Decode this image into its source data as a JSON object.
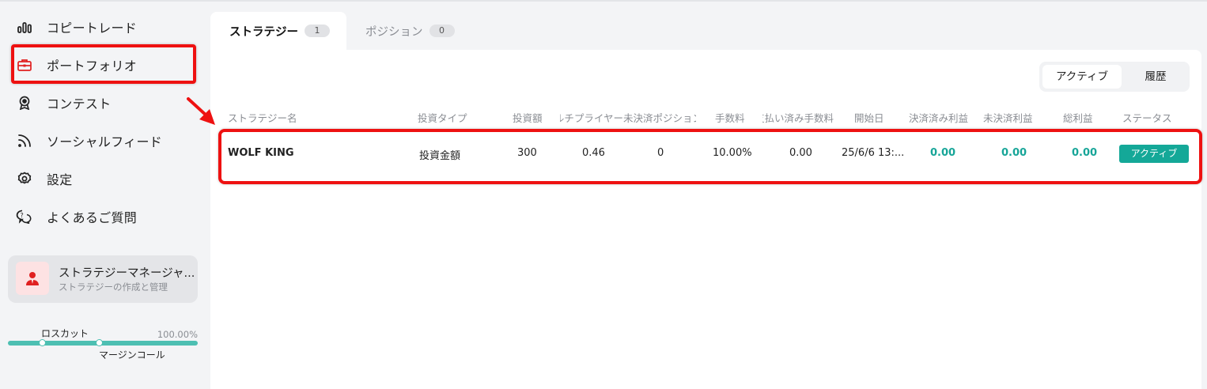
{
  "sidebar": {
    "items": [
      {
        "label": "コピートレード",
        "icon": "bar-chart-icon"
      },
      {
        "label": "ポートフォリオ",
        "icon": "briefcase-icon"
      },
      {
        "label": "コンテスト",
        "icon": "medal-icon"
      },
      {
        "label": "ソーシャルフィード",
        "icon": "rss-icon"
      },
      {
        "label": "設定",
        "icon": "gear-icon"
      },
      {
        "label": "よくあるご質問",
        "icon": "chat-question-icon"
      }
    ],
    "manager_card": {
      "title": "ストラテジーマネージャ...",
      "subtitle": "ストラテジーの作成と管理"
    },
    "risk": {
      "losscut_label": "ロスカット",
      "margin_call_label": "マージンコール",
      "percent": "100.00%"
    }
  },
  "tabs": [
    {
      "label": "ストラテジー",
      "count": "1"
    },
    {
      "label": "ポジション",
      "count": "0"
    }
  ],
  "segment": {
    "active": "アクティブ",
    "history": "履歴"
  },
  "table": {
    "headers": [
      "ストラテジー名",
      "投資タイプ",
      "投資額",
      "マルチプライヤー",
      "未決済ポジション",
      "手数料",
      "支払い済み手数料",
      "開始日",
      "決済済み利益",
      "未決済利益",
      "総利益",
      "ステータス"
    ],
    "rows": [
      {
        "name": "WOLF KING",
        "invest_type": "投資金額",
        "amount": "300",
        "multiplier": "0.46",
        "open_positions": "0",
        "fee": "10.00%",
        "paid_fee": "0.00",
        "start_date": "25/6/6 13:...",
        "closed_profit": "0.00",
        "open_profit": "0.00",
        "total_profit": "0.00",
        "status": "アクティブ"
      }
    ]
  },
  "colors": {
    "accent_teal": "#14a898",
    "highlight_red": "#ee1111",
    "background": "#f3f4f6"
  }
}
